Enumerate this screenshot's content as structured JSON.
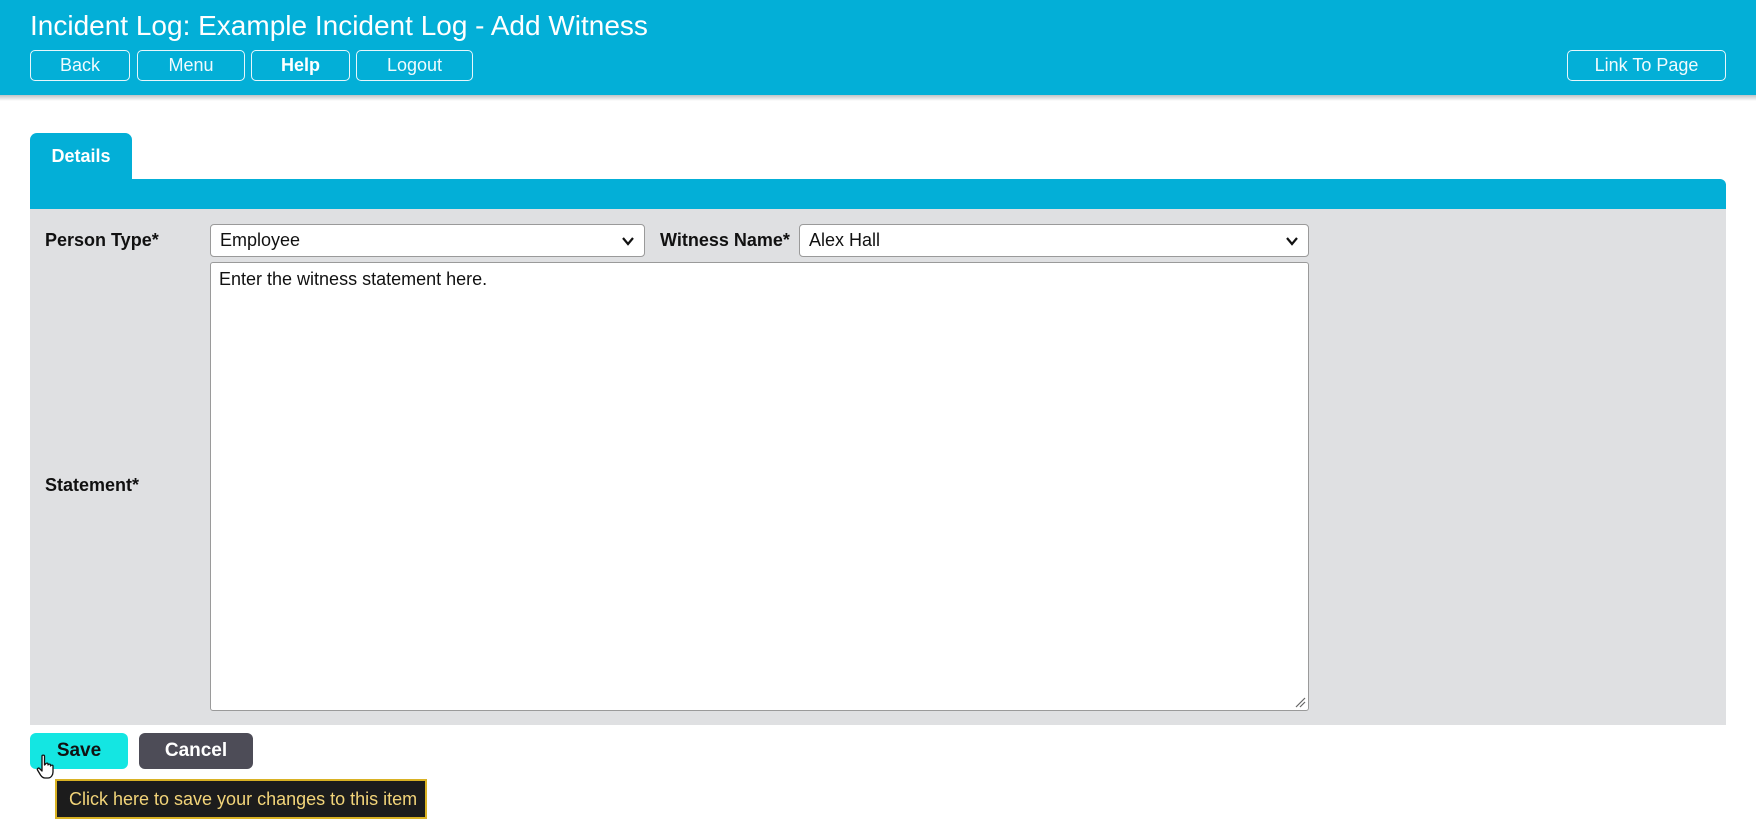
{
  "header": {
    "title": "Incident Log: Example Incident Log - Add Witness",
    "buttons": {
      "back": "Back",
      "menu": "Menu",
      "help": "Help",
      "logout": "Logout",
      "link_to_page": "Link To Page"
    }
  },
  "tabs": {
    "details": "Details"
  },
  "form": {
    "person_type_label": "Person Type*",
    "person_type_value": "Employee",
    "witness_name_label": "Witness Name*",
    "witness_name_value": "Alex Hall",
    "statement_label": "Statement*",
    "statement_value": "Enter the witness statement here."
  },
  "actions": {
    "save": "Save",
    "cancel": "Cancel"
  },
  "tooltip": {
    "save_hint": "Click here to save your changes to this item"
  },
  "colors": {
    "header": "#03afd7",
    "panel": "#dfe0e2",
    "save": "#14e6e2",
    "cancel": "#4d4c57",
    "tooltip_border": "#d9b224"
  },
  "icons": [
    "chevron-down-icon",
    "resize-grip-icon",
    "hand-pointer-cursor-icon"
  ]
}
